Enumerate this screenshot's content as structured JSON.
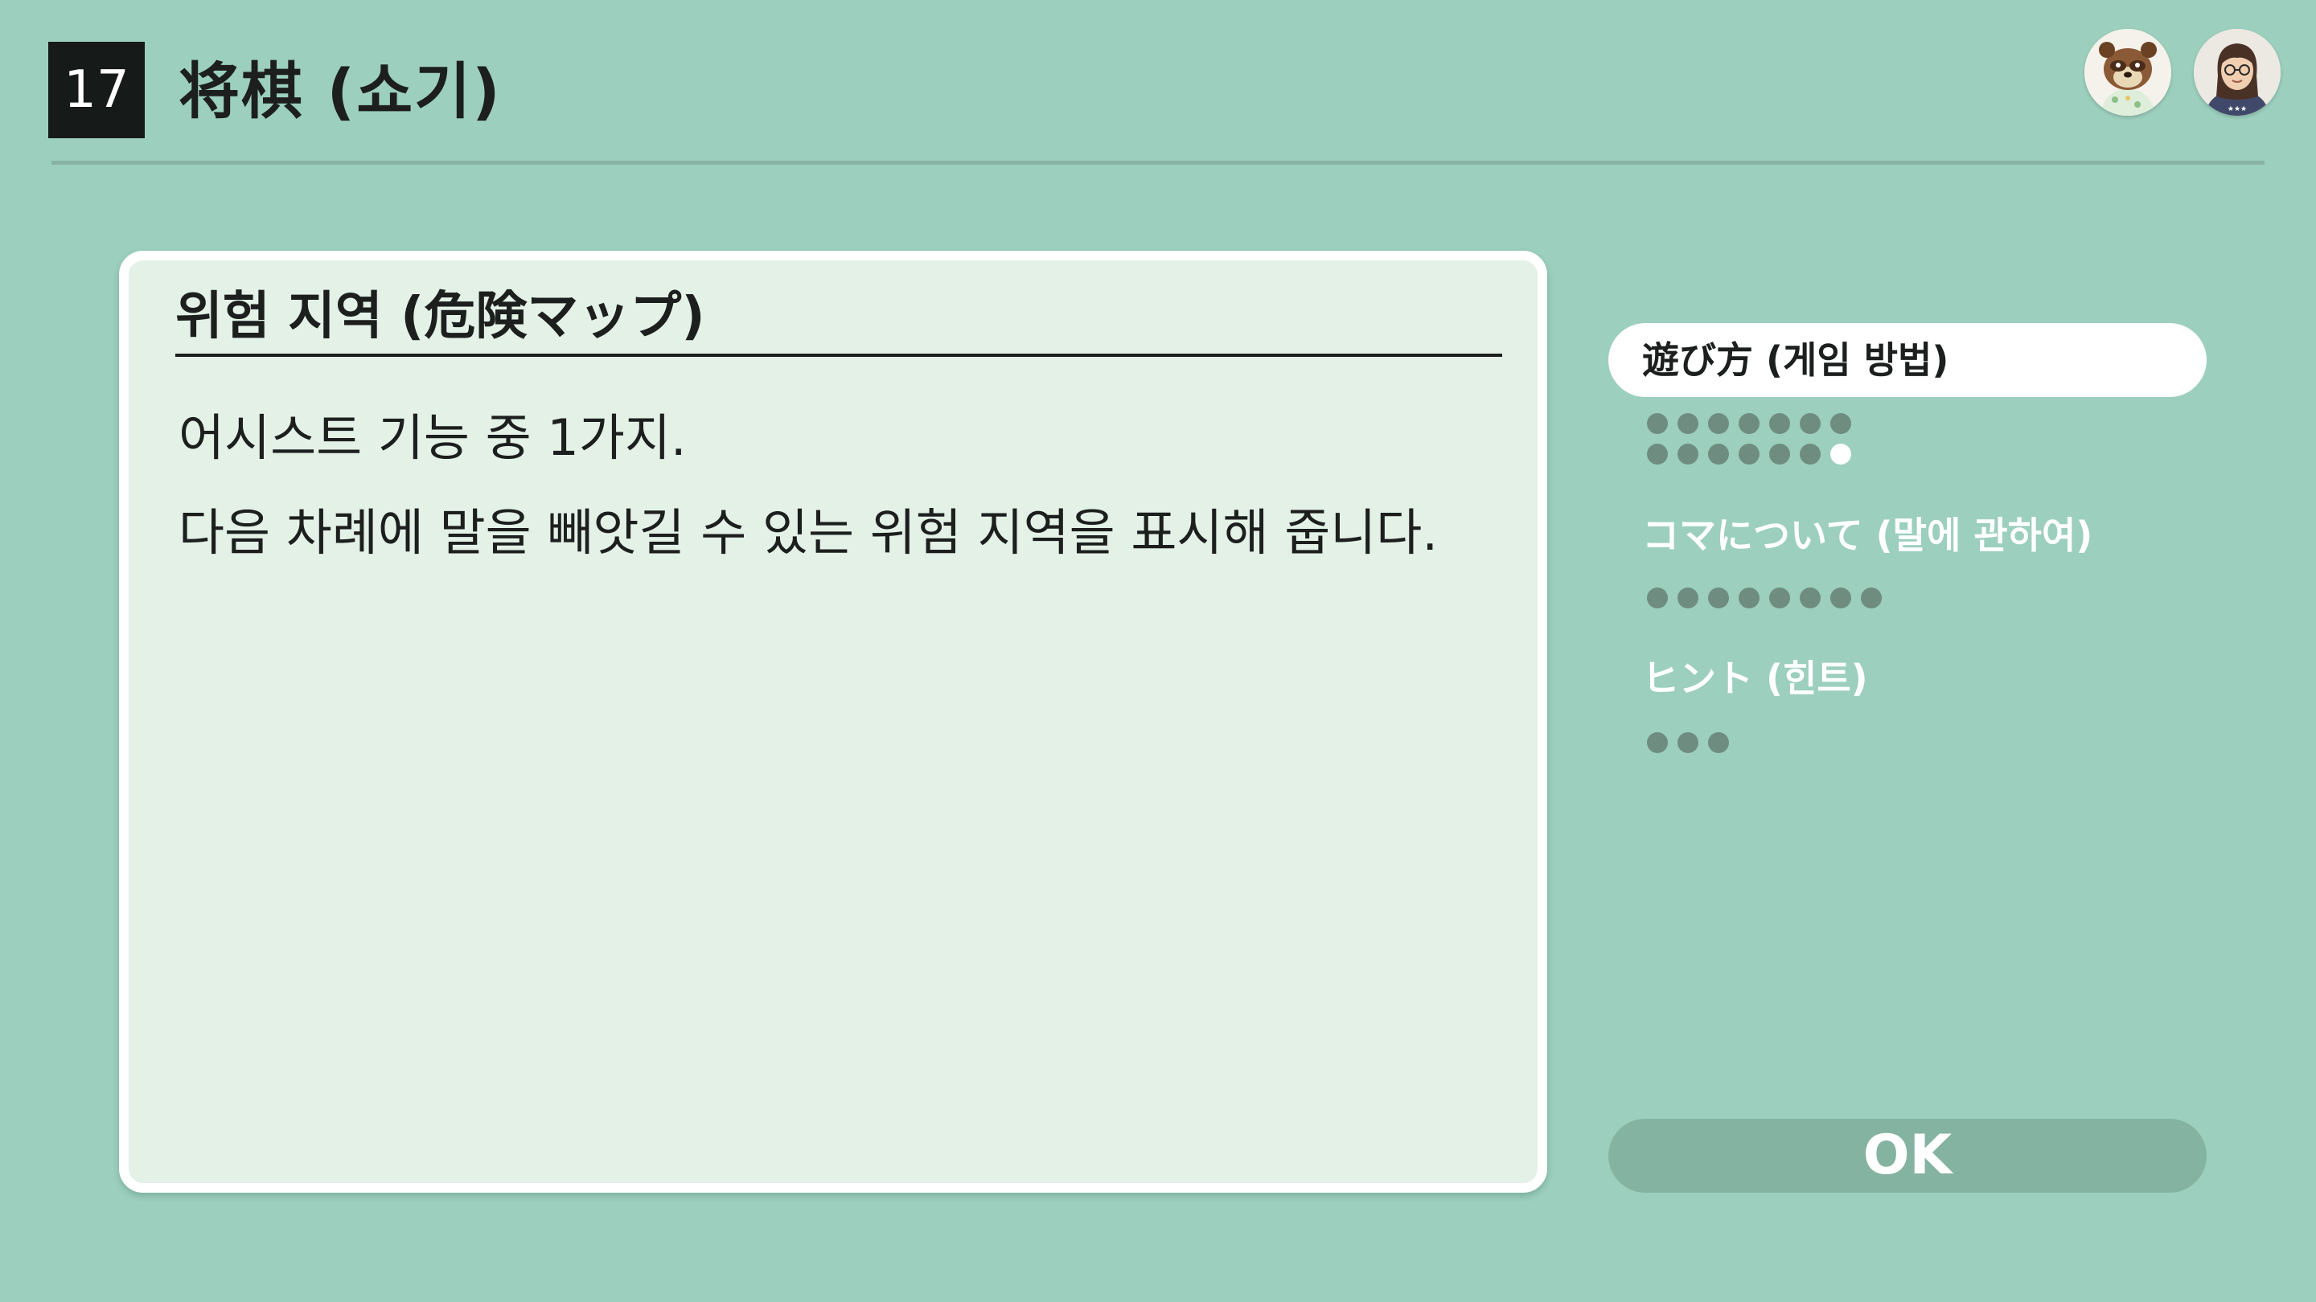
{
  "header": {
    "game_number": "17",
    "game_title": "将棋 (쇼기)"
  },
  "avatars": [
    {
      "icon": "raccoon-character-icon"
    },
    {
      "icon": "user-mii-icon"
    }
  ],
  "panel": {
    "heading": "위험 지역 (危険マップ)",
    "lines": [
      "어시스트 기능 중 1가지.",
      "다음 차례에 말을 빼앗길 수 있는 위험 지역을 표시해 줍니다."
    ]
  },
  "toc": {
    "items": [
      {
        "label": "遊び方 (게임 방법)",
        "active": true
      },
      {
        "label": "コマについて (말에 관하여)",
        "active": false
      },
      {
        "label": "ヒント (힌트)",
        "active": false
      }
    ],
    "page_counts": [
      14,
      8,
      3
    ],
    "current_page": {
      "section": 1,
      "page": 14
    }
  },
  "ok_button": {
    "label": "OK"
  },
  "colors": {
    "background": "#9ccfbd",
    "panel": "#e3f1e7",
    "dot_inactive": "#6f8c81",
    "dot_active": "#ffffff",
    "ok_button": "#85b3a2"
  }
}
